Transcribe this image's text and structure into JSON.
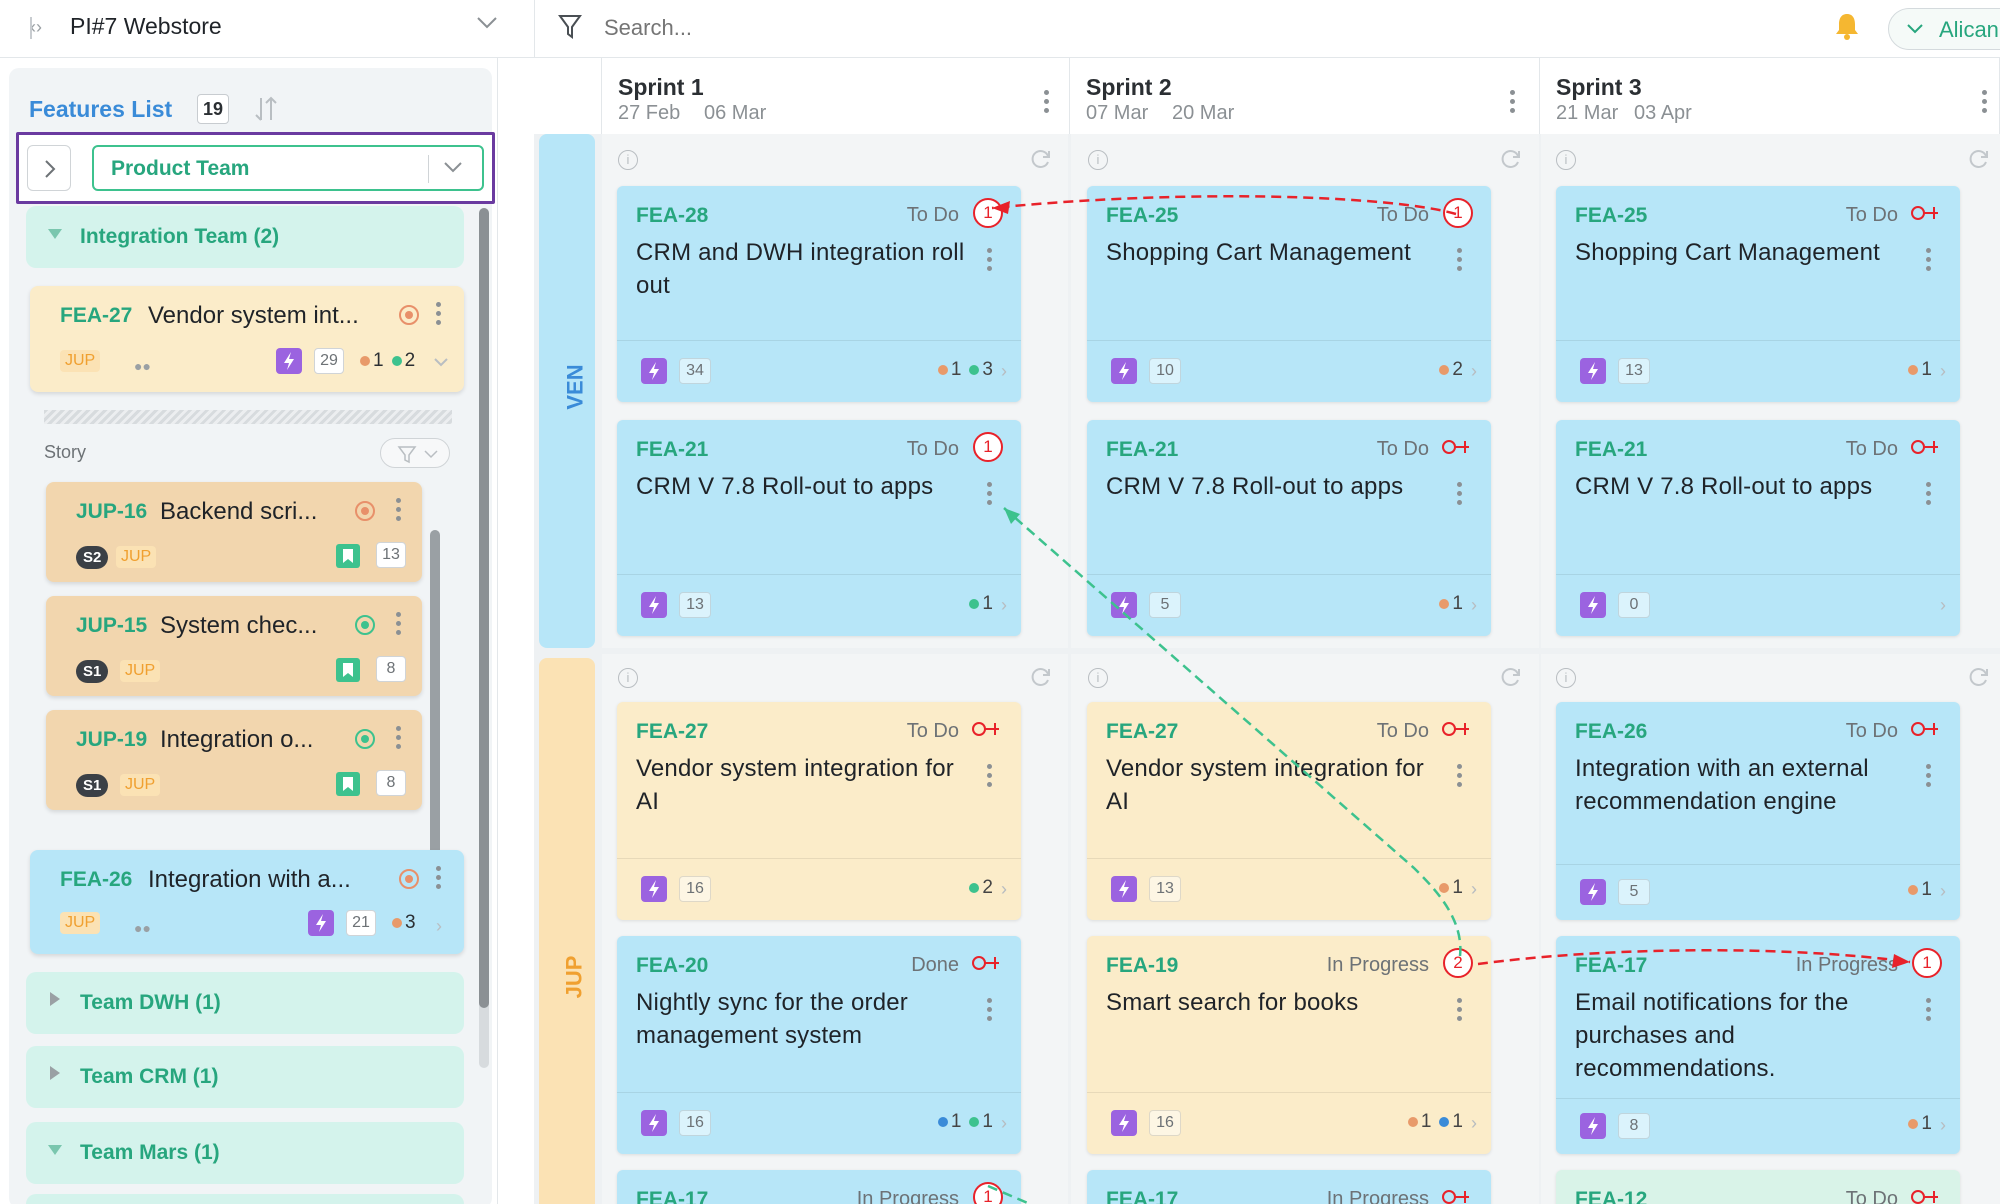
{
  "header": {
    "title": "PI#7 Webstore",
    "search_placeholder": "Search...",
    "user": "Alican"
  },
  "left": {
    "features_list": "Features List",
    "count": "19",
    "team_select": "Product Team",
    "groups": [
      {
        "label": "Integration Team (2)"
      },
      {
        "label": "Team DWH (1)"
      },
      {
        "label": "Team CRM (1)"
      },
      {
        "label": "Team Mars (1)"
      }
    ],
    "feature_a": {
      "id": "FEA-27",
      "title": "Vendor system int...",
      "team": "JUP",
      "count": "29",
      "o": "1",
      "g": "2"
    },
    "story_label": "Story",
    "stories": [
      {
        "id": "JUP-16",
        "title": "Backend scri...",
        "sprint": "S2",
        "team": "JUP",
        "count": "13"
      },
      {
        "id": "JUP-15",
        "title": "System chec...",
        "sprint": "S1",
        "team": "JUP",
        "count": "8"
      },
      {
        "id": "JUP-19",
        "title": "Integration o...",
        "sprint": "S1",
        "team": "JUP",
        "count": "8"
      }
    ],
    "feature_b": {
      "id": "FEA-26",
      "title": "Integration with a...",
      "team": "JUP",
      "count": "21",
      "o": "3"
    }
  },
  "sprints": [
    {
      "name": "Sprint 1",
      "start": "27 Feb",
      "end": "06 Mar"
    },
    {
      "name": "Sprint 2",
      "start": "07 Mar",
      "end": "20 Mar"
    },
    {
      "name": "Sprint 3",
      "start": "21 Mar",
      "end": "03 Apr"
    }
  ],
  "rows": [
    {
      "label": "VEN"
    },
    {
      "label": "JUP"
    }
  ],
  "cards": {
    "ven_s1_a": {
      "id": "FEA-28",
      "status": "To Do",
      "title": "CRM and DWH integration roll out",
      "count": "34",
      "s1": "1",
      "s2": "3",
      "badge": "1"
    },
    "ven_s2_a": {
      "id": "FEA-25",
      "status": "To Do",
      "title": "Shopping Cart Management",
      "count": "10",
      "s1": "2",
      "badge": "1"
    },
    "ven_s3_a": {
      "id": "FEA-25",
      "status": "To Do",
      "title": "Shopping Cart Management",
      "count": "13",
      "s1": "1"
    },
    "ven_s1_b": {
      "id": "FEA-21",
      "status": "To Do",
      "title": "CRM V 7.8 Roll-out to apps",
      "count": "13",
      "s1": "1",
      "badge": "1"
    },
    "ven_s2_b": {
      "id": "FEA-21",
      "status": "To Do",
      "title": "CRM V 7.8 Roll-out to apps",
      "count": "5",
      "s1": "1"
    },
    "ven_s3_b": {
      "id": "FEA-21",
      "status": "To Do",
      "title": "CRM V 7.8 Roll-out to apps",
      "count": "0"
    },
    "jup_s1_a": {
      "id": "FEA-27",
      "status": "To Do",
      "title": "Vendor system integration for AI",
      "count": "16",
      "s1": "2"
    },
    "jup_s2_a": {
      "id": "FEA-27",
      "status": "To Do",
      "title": "Vendor system integration for AI",
      "count": "13",
      "s1": "1"
    },
    "jup_s3_a": {
      "id": "FEA-26",
      "status": "To Do",
      "title": "Integration with an external recommendation engine",
      "count": "5",
      "s1": "1"
    },
    "jup_s1_b": {
      "id": "FEA-20",
      "status": "Done",
      "title": "Nightly sync for the order management system",
      "count": "16",
      "s1": "1",
      "s2": "1"
    },
    "jup_s2_b": {
      "id": "FEA-19",
      "status": "In Progress",
      "title": "Smart search for books",
      "count": "16",
      "s1": "1",
      "s2": "1",
      "badge": "2"
    },
    "jup_s3_b": {
      "id": "FEA-17",
      "status": "In Progress",
      "title": "Email notifications for the purchases and recommendations.",
      "count": "8",
      "s1": "1",
      "badge": "1"
    },
    "jup_s1_c": {
      "id": "FEA-17",
      "status": "In Progress",
      "badge": "1"
    },
    "jup_s2_c": {
      "id": "FEA-17",
      "status": "In Progress"
    },
    "jup_s3_c": {
      "id": "FEA-12",
      "status": "To Do"
    }
  },
  "colors": {
    "accent": "#27a67e",
    "blue_card": "#b7e6f8",
    "yellow_card": "#fbecc9",
    "dependency_red": "#e8222a",
    "dependency_green": "#3dc28e"
  }
}
